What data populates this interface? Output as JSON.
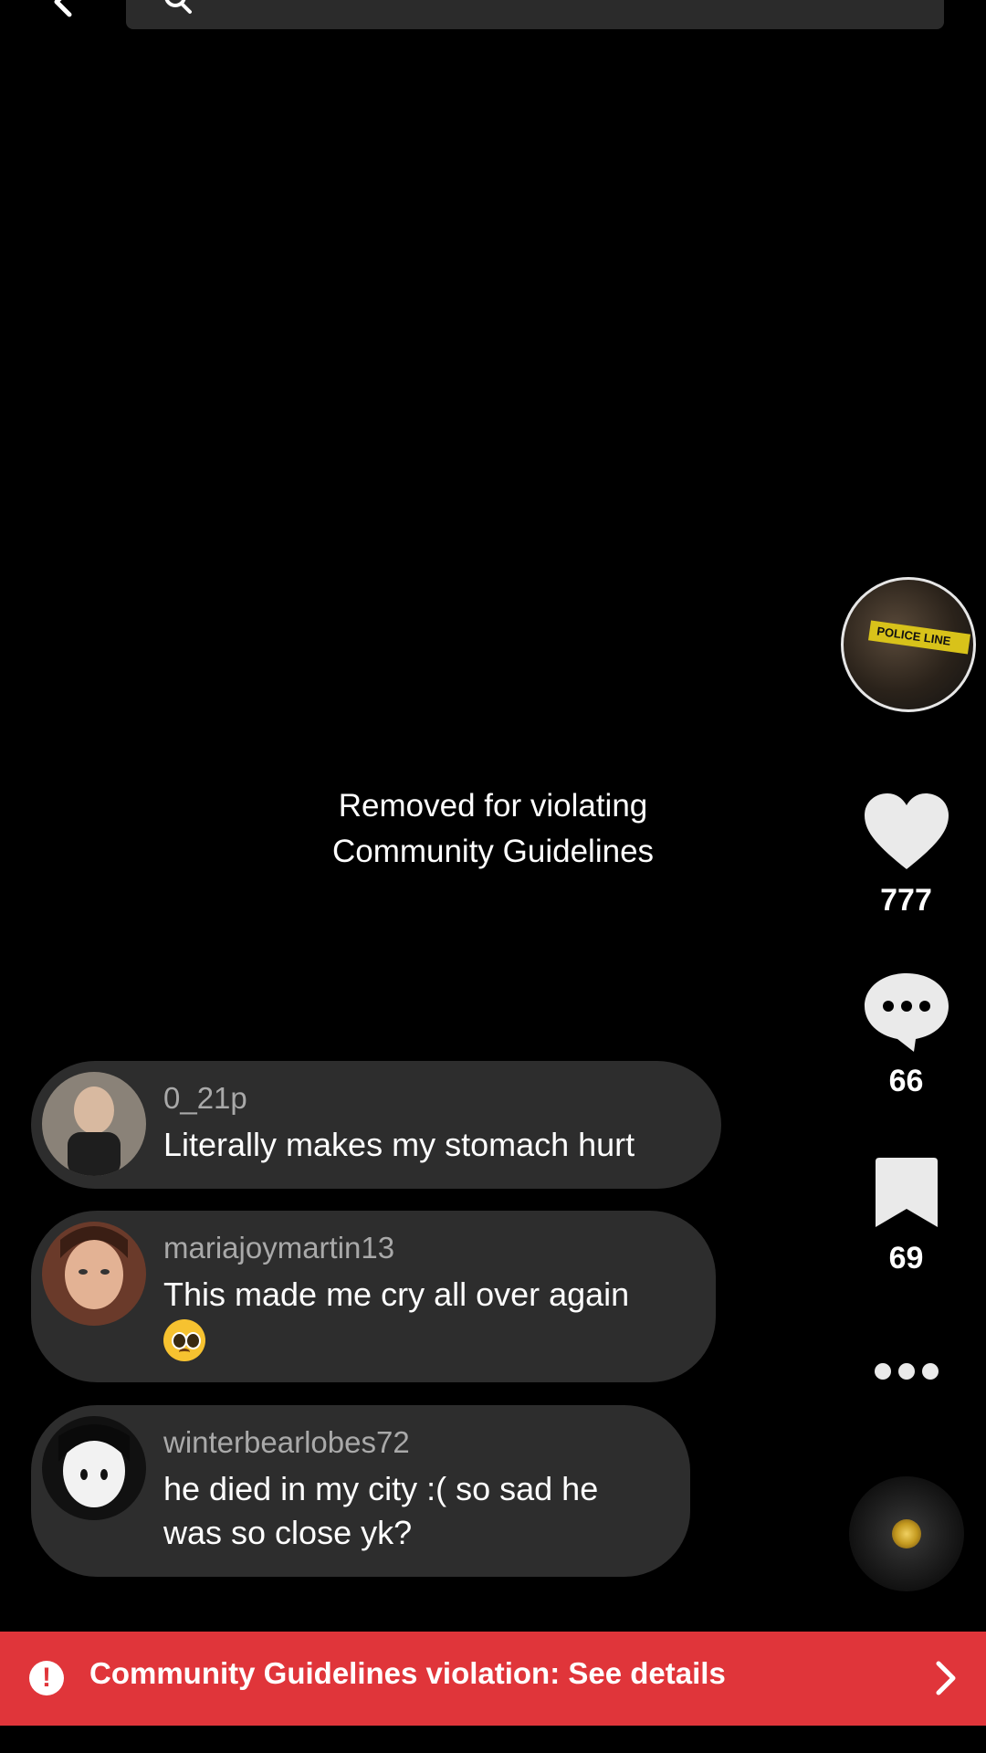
{
  "topbar": {
    "search_placeholder": ""
  },
  "video": {
    "removed_line1": "Removed for violating",
    "removed_line2": "Community Guidelines"
  },
  "rail": {
    "likes": "777",
    "comments": "66",
    "saves": "69",
    "creator_avatar_text": "POLICE LINE"
  },
  "comments": [
    {
      "username": "0_21p",
      "text": "Literally makes my stomach hurt"
    },
    {
      "username": "mariajoymartin13",
      "text": "This made me cry all over again",
      "emoji": "pleading-face"
    },
    {
      "username": "winterbearlobes72",
      "text_line1": "he died in my city :( so sad he",
      "text_line2": "was so close yk?"
    }
  ],
  "violation_banner": {
    "text": "Community Guidelines violation: See details"
  },
  "colors": {
    "banner": "#e0353a",
    "comment_bubble": "#2d2d2d",
    "background": "#000000"
  },
  "icons": [
    "back-icon",
    "search-icon",
    "heart-icon",
    "comment-icon",
    "bookmark-icon",
    "more-icon",
    "music-disc-icon",
    "alert-icon",
    "chevron-right-icon"
  ]
}
